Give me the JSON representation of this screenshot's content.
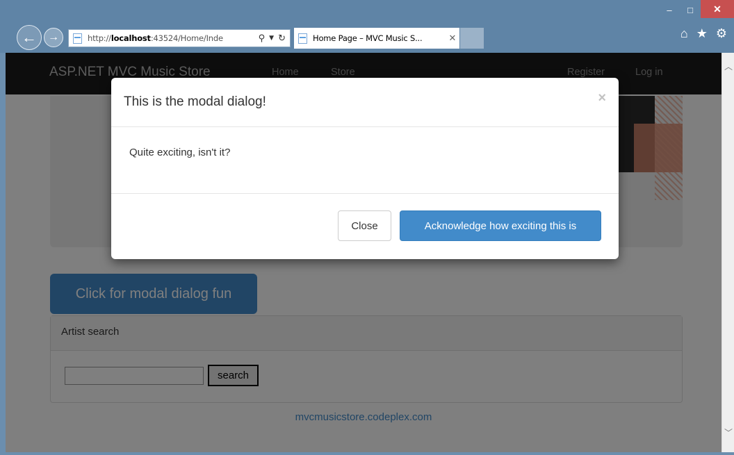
{
  "browser": {
    "window_controls": {
      "minimize": "–",
      "maximize": "□",
      "close": "✕"
    },
    "address": {
      "prefix": "http://",
      "host": "localhost",
      "rest": ":43524/Home/Inde"
    },
    "tab": {
      "title": "Home Page – MVC Music S...",
      "close": "✕"
    },
    "toolbar_icons": [
      "home-icon",
      "favorites-star-icon",
      "settings-gear-icon"
    ]
  },
  "navbar": {
    "brand": "ASP.NET MVC Music Store",
    "links": [
      "Home",
      "Store"
    ],
    "right_links": [
      "Register",
      "Log in"
    ]
  },
  "main": {
    "modal_button": "Click for modal dialog fun",
    "search_panel": {
      "heading": "Artist search",
      "input_value": "",
      "button": "search"
    },
    "footer_link": "mvcmusicstore.codeplex.com"
  },
  "modal": {
    "title": "This is the modal dialog!",
    "close_x": "×",
    "body": "Quite exciting, isn't it?",
    "close_button": "Close",
    "primary_button": "Acknowledge how exciting this is"
  },
  "colors": {
    "chrome": "#5f84a6",
    "navbar": "#1b1b1b",
    "primary": "#428bca",
    "backdrop": "rgba(0,0,0,0.5)"
  }
}
